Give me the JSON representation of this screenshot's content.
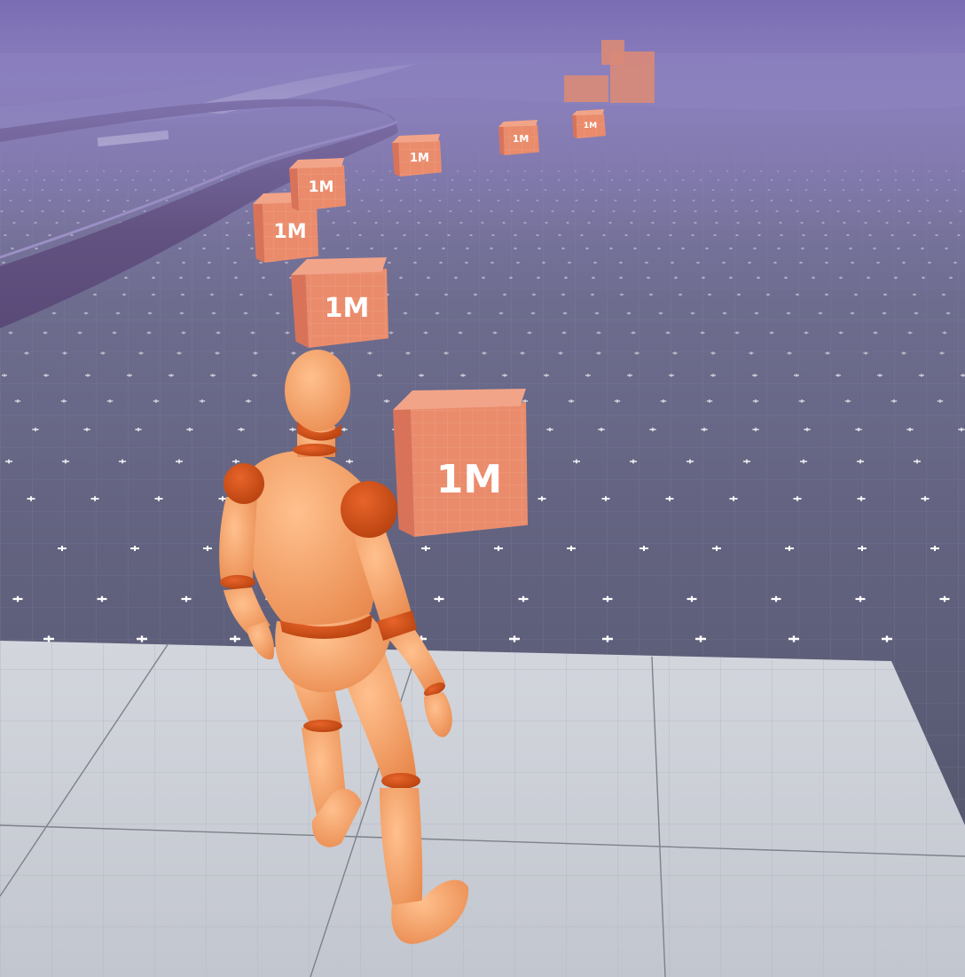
{
  "scene": {
    "description_free": true,
    "sky_color": "#7e72b6",
    "fog_color": "#9f95c8",
    "grid_floor_color": "#5f6178",
    "platform_color": "#c9cdd4",
    "mannequin_skin": "#f0a066",
    "mannequin_joint": "#d9581f",
    "cube_color": "#e98a68"
  },
  "cubes": [
    {
      "label": "1M"
    },
    {
      "label": "1M"
    },
    {
      "label": "1M"
    },
    {
      "label": "1M"
    },
    {
      "label": "1M"
    },
    {
      "label": "1M"
    },
    {
      "label": "1M"
    }
  ]
}
